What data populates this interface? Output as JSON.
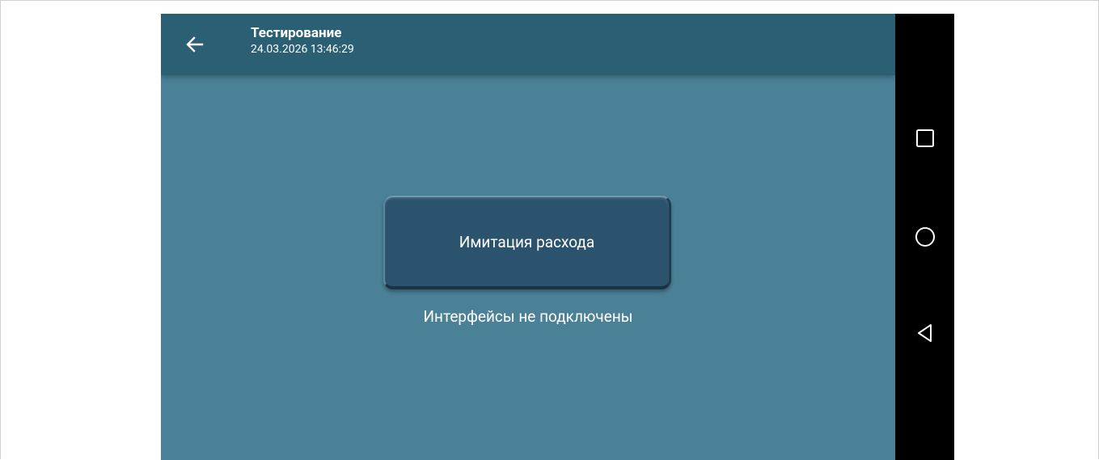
{
  "app": {
    "title": "Тестирование",
    "datetime": "24.03.2026 13:46:29"
  },
  "icons": {
    "back": "arrow-left-icon",
    "recent": "square-icon",
    "home": "circle-icon",
    "nav_back": "triangle-left-icon"
  },
  "main": {
    "button_label": "Имитация расхода",
    "status_text": "Интерфейсы не подключены"
  },
  "colors": {
    "appbar": "#2a5f74",
    "background": "#4a8197",
    "button": "#2b536e",
    "navbar": "#000000",
    "text": "#ffffff"
  }
}
